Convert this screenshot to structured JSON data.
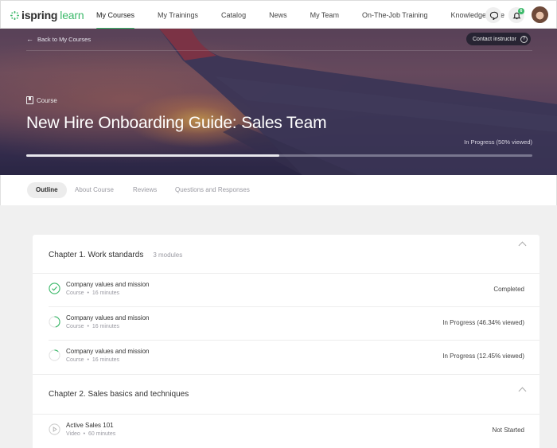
{
  "brand": {
    "name_bold": "ispring",
    "name_light": "learn",
    "accent": "#3cb96a"
  },
  "nav": {
    "items": [
      {
        "label": "My Courses",
        "active": true
      },
      {
        "label": "My Trainings"
      },
      {
        "label": "Catalog"
      },
      {
        "label": "News"
      },
      {
        "label": "My Team"
      },
      {
        "label": "On-The-Job Training"
      },
      {
        "label": "Knowledge Base"
      }
    ],
    "notifications_count": "6"
  },
  "hero": {
    "back_label": "Back to My Courses",
    "contact_label": "Contact instructor",
    "contact_help": "?",
    "type_label": "Course",
    "title": "New Hire Onboarding Guide: Sales Team",
    "status": "In Progress (50% viewed)",
    "progress_percent": 50
  },
  "tabs": [
    {
      "label": "Outline",
      "active": true
    },
    {
      "label": "About Course"
    },
    {
      "label": "Reviews"
    },
    {
      "label": "Questions and Responses"
    }
  ],
  "chapters": [
    {
      "title": "Chapter 1. Work standards",
      "meta": "3 modules",
      "modules": [
        {
          "title": "Company values and mission",
          "type": "Course",
          "duration": "16 minutes",
          "status": "Completed",
          "icon": "check-circle-icon",
          "progress": 100
        },
        {
          "title": "Company values and mission",
          "type": "Course",
          "duration": "16 minutes",
          "status": "In Progress (46.34% viewed)",
          "icon": "progress-ring-icon",
          "progress": 46.34
        },
        {
          "title": "Company values and mission",
          "type": "Course",
          "duration": "16 minutes",
          "status": "In Progress (12.45% viewed)",
          "icon": "progress-ring-icon",
          "progress": 12.45
        }
      ]
    },
    {
      "title": "Chapter 2. Sales basics and techniques",
      "meta": "",
      "modules": [
        {
          "title": "Active Sales 101",
          "type": "Video",
          "duration": "60 minutes",
          "status": "Not Started",
          "icon": "play-circle-icon",
          "progress": 0
        }
      ]
    }
  ],
  "separator": "•"
}
